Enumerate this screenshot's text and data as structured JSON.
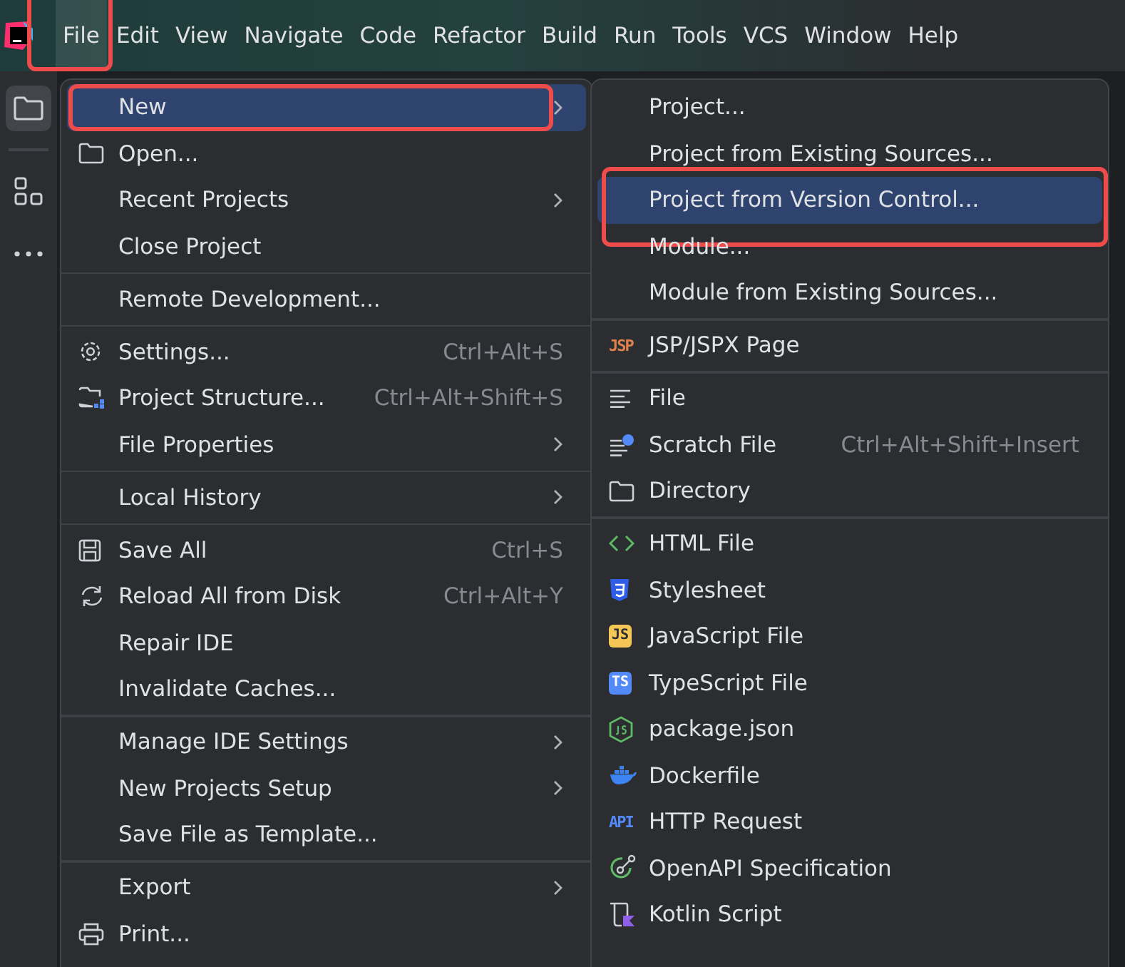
{
  "menu_bar": {
    "items": [
      {
        "label": "File",
        "selected": true,
        "highlighted": true
      },
      {
        "label": "Edit",
        "selected": false,
        "highlighted": false
      },
      {
        "label": "View",
        "selected": false,
        "highlighted": false
      },
      {
        "label": "Navigate",
        "selected": false,
        "highlighted": false
      },
      {
        "label": "Code",
        "selected": false,
        "highlighted": false
      },
      {
        "label": "Refactor",
        "selected": false,
        "highlighted": false
      },
      {
        "label": "Build",
        "selected": false,
        "highlighted": false
      },
      {
        "label": "Run",
        "selected": false,
        "highlighted": false
      },
      {
        "label": "Tools",
        "selected": false,
        "highlighted": false
      },
      {
        "label": "VCS",
        "selected": false,
        "highlighted": false
      },
      {
        "label": "Window",
        "selected": false,
        "highlighted": false
      },
      {
        "label": "Help",
        "selected": false,
        "highlighted": false
      }
    ]
  },
  "sidebar": {
    "items": [
      {
        "kind": "folder",
        "selected": true
      },
      {
        "kind": "structure",
        "selected": false
      },
      {
        "kind": "more",
        "selected": false
      }
    ]
  },
  "file_menu": {
    "groups": [
      [
        {
          "label": "New",
          "submenu": true,
          "selected": true,
          "highlighted": true
        },
        {
          "label": "Open...",
          "kind": "folder",
          "submenu": false,
          "selected": false,
          "highlighted": false
        },
        {
          "label": "Recent Projects",
          "submenu": true,
          "selected": false,
          "highlighted": false
        },
        {
          "label": "Close Project",
          "submenu": false,
          "selected": false,
          "highlighted": false
        }
      ],
      [
        {
          "label": "Remote Development...",
          "submenu": false,
          "selected": false,
          "highlighted": false
        }
      ],
      [
        {
          "label": "Settings...",
          "kind": "gear",
          "shortcut": "Ctrl+Alt+S",
          "submenu": false,
          "selected": false,
          "highlighted": false
        },
        {
          "label": "Project Structure...",
          "kind": "structure",
          "shortcut": "Ctrl+Alt+Shift+S",
          "submenu": false,
          "selected": false,
          "highlighted": false
        },
        {
          "label": "File Properties",
          "submenu": true,
          "selected": false,
          "highlighted": false
        }
      ],
      [
        {
          "label": "Local History",
          "submenu": true,
          "selected": false,
          "highlighted": false
        }
      ],
      [
        {
          "label": "Save All",
          "kind": "save",
          "shortcut": "Ctrl+S",
          "submenu": false,
          "selected": false,
          "highlighted": false
        },
        {
          "label": "Reload All from Disk",
          "kind": "reload",
          "shortcut": "Ctrl+Alt+Y",
          "submenu": false,
          "selected": false,
          "highlighted": false
        },
        {
          "label": "Repair IDE",
          "submenu": false,
          "selected": false,
          "highlighted": false
        },
        {
          "label": "Invalidate Caches...",
          "submenu": false,
          "selected": false,
          "highlighted": false
        }
      ],
      [
        {
          "label": "Manage IDE Settings",
          "submenu": true,
          "selected": false,
          "highlighted": false
        },
        {
          "label": "New Projects Setup",
          "submenu": true,
          "selected": false,
          "highlighted": false
        },
        {
          "label": "Save File as Template...",
          "submenu": false,
          "selected": false,
          "highlighted": false
        }
      ],
      [
        {
          "label": "Export",
          "submenu": true,
          "selected": false,
          "highlighted": false
        },
        {
          "label": "Print...",
          "kind": "print",
          "submenu": false,
          "selected": false,
          "highlighted": false
        }
      ]
    ]
  },
  "new_submenu": {
    "groups": [
      [
        {
          "label": "Project...",
          "selected": false,
          "highlighted": false
        },
        {
          "label": "Project from Existing Sources...",
          "selected": false,
          "highlighted": false
        },
        {
          "label": "Project from Version Control...",
          "selected": true,
          "highlighted": true
        },
        {
          "label": "Module...",
          "selected": false,
          "highlighted": false
        },
        {
          "label": "Module from Existing Sources...",
          "selected": false,
          "highlighted": false
        }
      ],
      [
        {
          "label": "JSP/JSPX Page",
          "kind": "jsp",
          "badge": "JSP",
          "selected": false,
          "highlighted": false
        }
      ],
      [
        {
          "label": "File",
          "kind": "lines",
          "selected": false,
          "highlighted": false
        },
        {
          "label": "Scratch File",
          "kind": "scratch",
          "shortcut": "Ctrl+Alt+Shift+Insert",
          "selected": false,
          "highlighted": false
        },
        {
          "label": "Directory",
          "kind": "folder",
          "selected": false,
          "highlighted": false
        }
      ],
      [
        {
          "label": "HTML File",
          "kind": "html",
          "selected": false,
          "highlighted": false
        },
        {
          "label": "Stylesheet",
          "kind": "css",
          "selected": false,
          "highlighted": false
        },
        {
          "label": "JavaScript File",
          "kind": "js",
          "badge": "JS",
          "selected": false,
          "highlighted": false
        },
        {
          "label": "TypeScript File",
          "kind": "ts",
          "badge": "TS",
          "selected": false,
          "highlighted": false
        },
        {
          "label": "package.json",
          "kind": "node",
          "selected": false,
          "highlighted": false
        },
        {
          "label": "Dockerfile",
          "kind": "docker",
          "selected": false,
          "highlighted": false
        },
        {
          "label": "HTTP Request",
          "kind": "api",
          "badge": "API",
          "selected": false,
          "highlighted": false
        },
        {
          "label": "OpenAPI Specification",
          "kind": "openapi",
          "selected": false,
          "highlighted": false
        },
        {
          "label": "Kotlin Script",
          "kind": "kotlin",
          "selected": false,
          "highlighted": false
        }
      ]
    ]
  }
}
